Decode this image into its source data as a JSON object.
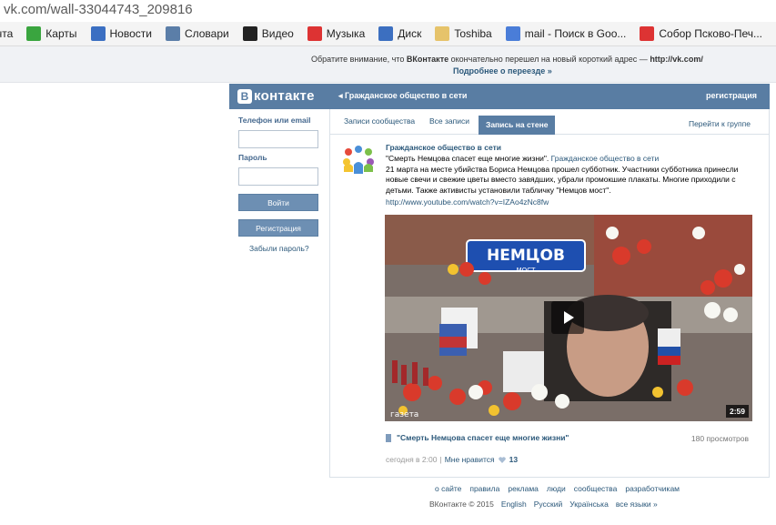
{
  "browser": {
    "url": "vk.com/wall-33044743_209816",
    "bookmarks": [
      {
        "label": "чта",
        "icon": "mail-icon",
        "color": "#ffffff"
      },
      {
        "label": "Карты",
        "icon": "maps-icon",
        "color": "#3aa53f"
      },
      {
        "label": "Новости",
        "icon": "news-icon",
        "color": "#3b6fc2"
      },
      {
        "label": "Словари",
        "icon": "dictionary-icon",
        "color": "#5b7ea8"
      },
      {
        "label": "Видео",
        "icon": "video-icon",
        "color": "#222222"
      },
      {
        "label": "Музыка",
        "icon": "music-icon",
        "color": "#d33"
      },
      {
        "label": "Диск",
        "icon": "disk-icon",
        "color": "#3c6fc0"
      },
      {
        "label": "Toshiba",
        "icon": "folder-icon",
        "color": "#e6c36a"
      },
      {
        "label": "mail - Поиск в Goo...",
        "icon": "google-icon",
        "color": "#4a7dd8"
      },
      {
        "label": "Собор Псково-Печ...",
        "icon": "yandex-icon",
        "color": "#d33"
      },
      {
        "label": "",
        "icon": "yandex-icon",
        "color": "#d33"
      }
    ]
  },
  "notice": {
    "prefix": "Обратите внимание, что ",
    "brand": "ВКонтакте",
    "suffix": " окончательно перешел на новый короткий адрес — ",
    "addr": "http://vk.com/",
    "more": "Подробнее о переезде »"
  },
  "header": {
    "logo_letter": "В",
    "logo_text": "контакте",
    "back_link": "Гражданское общество в сети",
    "register": "регистрация"
  },
  "login": {
    "phone_label": "Телефон или email",
    "password_label": "Пароль",
    "login_button": "Войти",
    "register_button": "Регистрация",
    "forgot": "Забыли пароль?"
  },
  "tabs": {
    "community_posts": "Записи сообщества",
    "all_posts": "Все записи",
    "wall_post": "Запись на стене",
    "go_to_group": "Перейти к группе"
  },
  "post": {
    "author": "Гражданское общество в сети",
    "quote": "\"Смерть Немцова спасет еще многие жизни\". ",
    "source_link": "Гражданское общество в сети",
    "text": "21 марта на месте убийства Бориса Немцова прошел субботник. Участники субботника принесли новые свечи и свежие цветы вместо завядших, убрали промокшие плакаты. Многие приходили с детьми. Также активисты установили табличку \"Немцов мост\".",
    "link": "http://www.youtube.com/watch?v=IZAo4zNc8fw",
    "video": {
      "duration": "2:59",
      "title": "\"Смерть Немцова спасет еще многие жизни\"",
      "views": "180 просмотров",
      "sign_text": "НЕМЦОВ",
      "sign_sub": "МОСТ",
      "watermark": "газета"
    },
    "time": "сегодня в 2:00",
    "sep": "|",
    "like_label": "Мне нравится",
    "likes": "13"
  },
  "footer": {
    "links": [
      "о сайте",
      "правила",
      "реклама",
      "люди",
      "сообщества",
      "разработчикам"
    ],
    "copyright": "ВКонтакте © 2015",
    "languages": [
      "English",
      "Русский",
      "Українська",
      "все языки »"
    ]
  }
}
